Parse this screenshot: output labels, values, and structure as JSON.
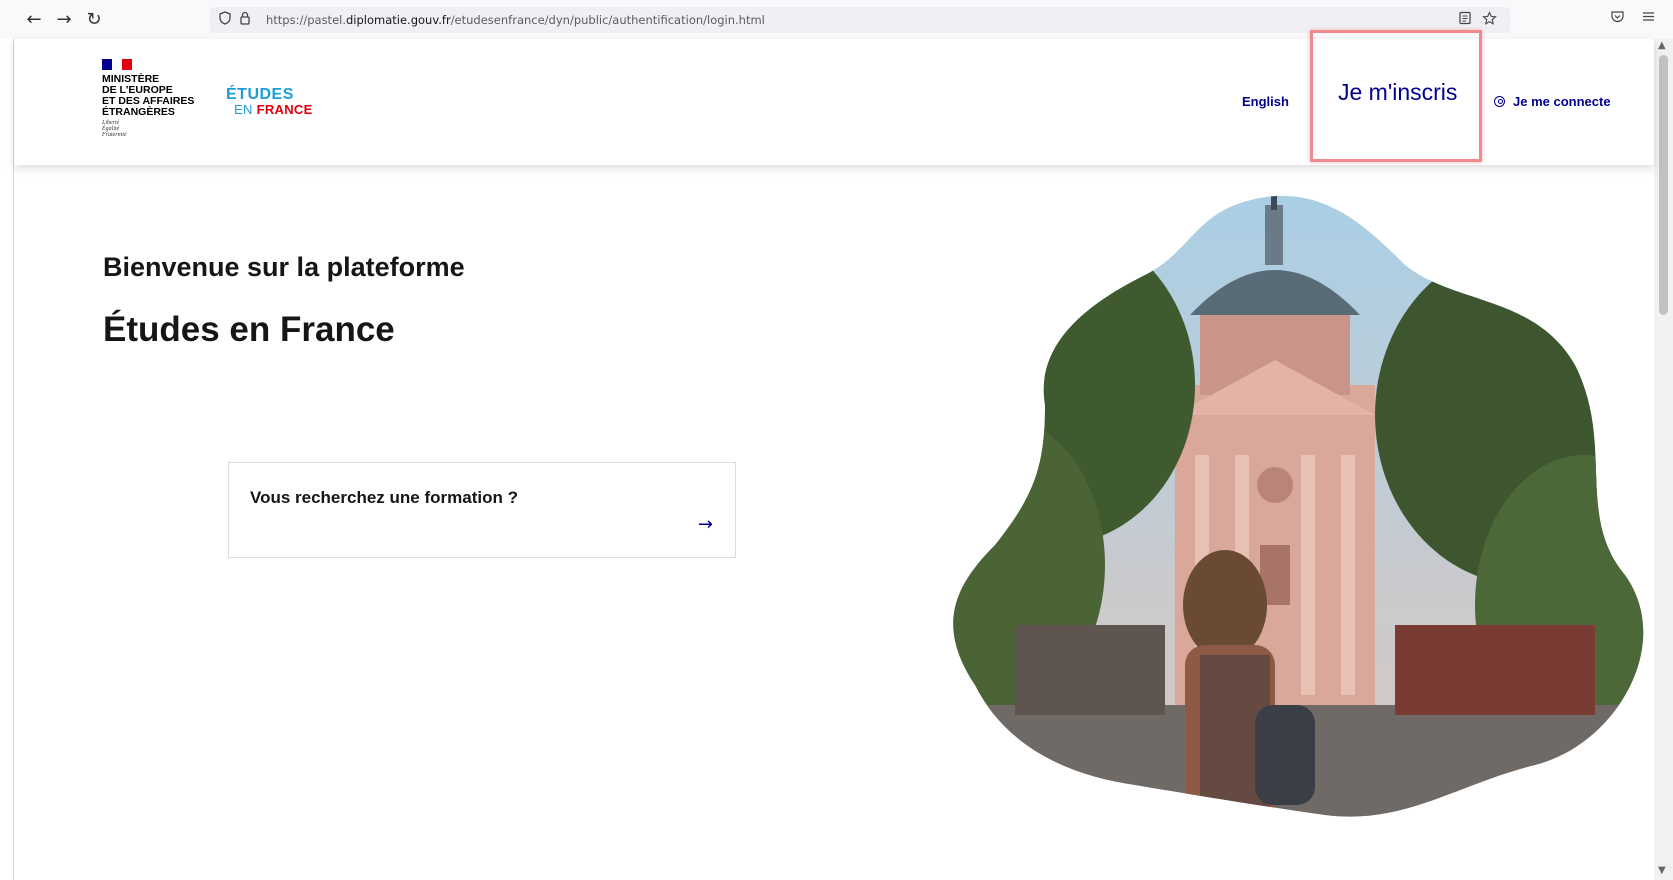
{
  "browser": {
    "back_glyph": "←",
    "forward_glyph": "→",
    "reload_glyph": "↻",
    "url_prefix": "https://pastel.",
    "url_domain": "diplomatie.gouv.fr",
    "url_path": "/etudesenfrance/dyn/public/authentification/login.html",
    "icons": [
      "back-icon",
      "forward-icon",
      "reload-icon",
      "shield-icon",
      "lock-icon",
      "reader-view-icon",
      "bookmark-star-icon",
      "pocket-icon",
      "menu-icon"
    ]
  },
  "header": {
    "ministry_text": "MINISTÈRE\nDE L'EUROPE\nET DES AFFAIRES\nÉTRANGÈRES",
    "motto": "Liberté\nÉgalité\nFraternité",
    "etudes_logo_top": "ÉTUDES",
    "etudes_logo_en": "EN ",
    "etudes_logo_france": "FRANCE",
    "language_link": "English",
    "signup_link": "Je m'inscris",
    "login_link": "Je me connecte"
  },
  "main": {
    "welcome": "Bienvenue sur la plateforme",
    "title": "Études en France",
    "search_card_label": "Vous recherchez une formation ?",
    "search_card_arrow": "→"
  },
  "colors": {
    "brand_blue": "#000091",
    "logo_cyan": "#1e9dd9",
    "marianne_red": "#e1000f",
    "highlight_border": "#f08a8c"
  }
}
